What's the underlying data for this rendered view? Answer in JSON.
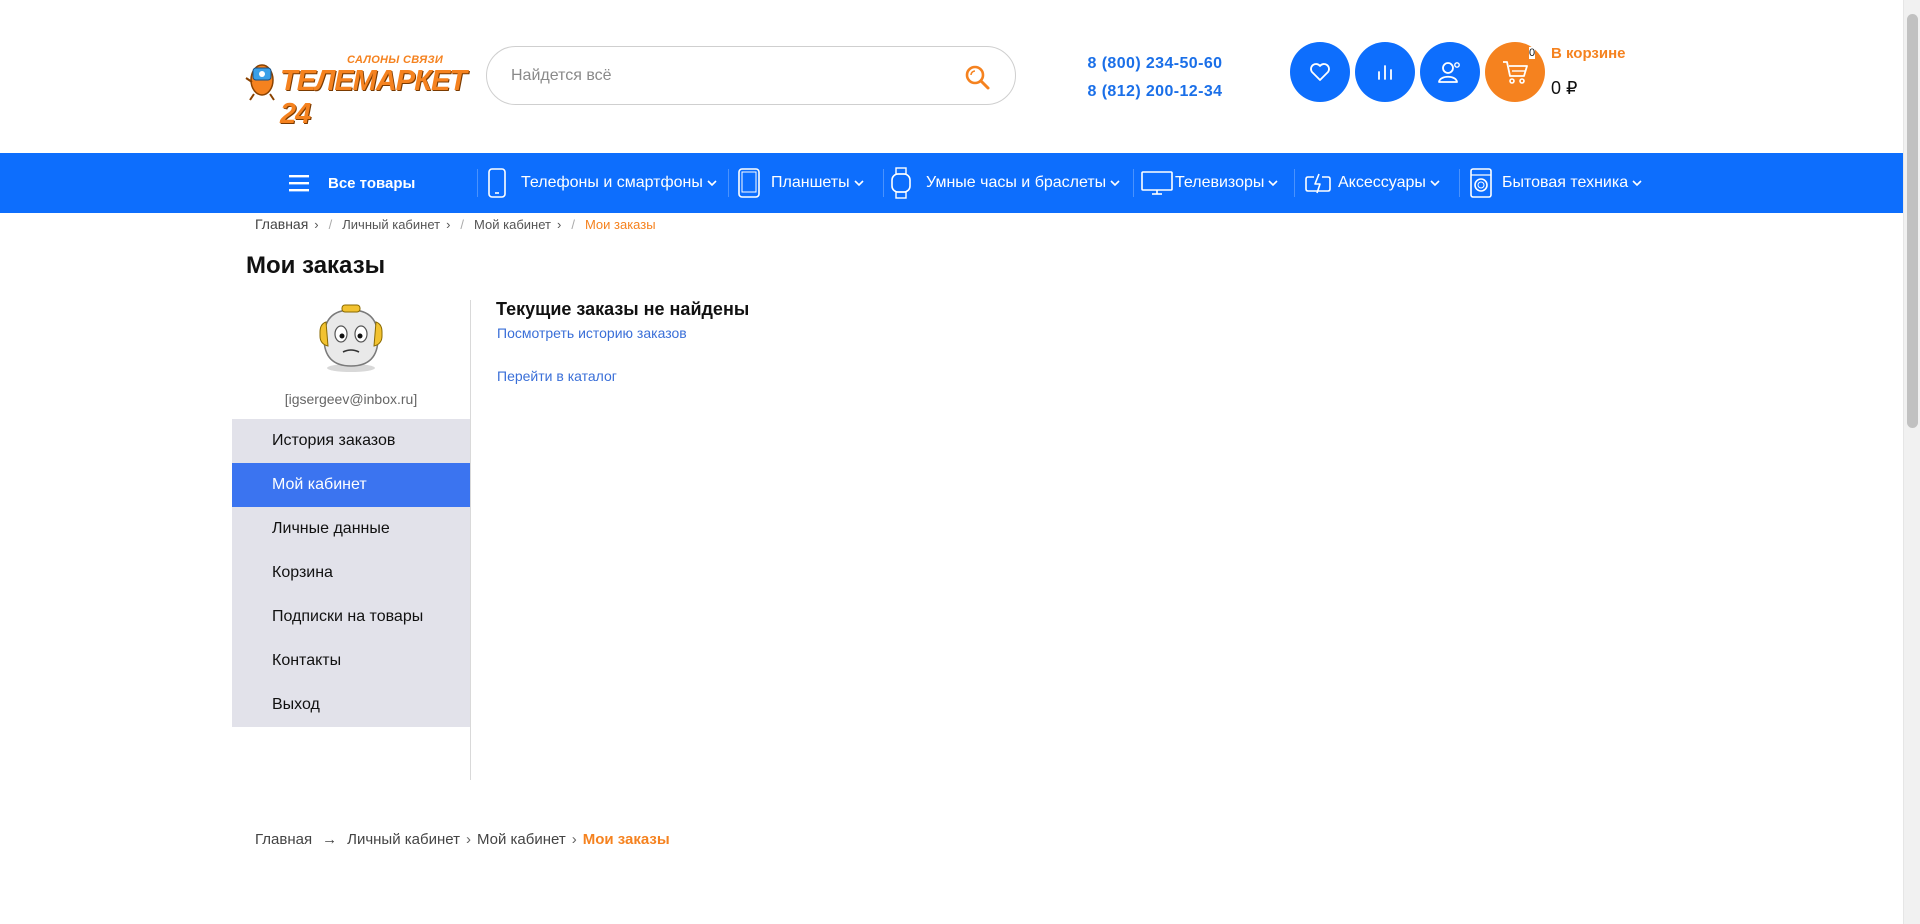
{
  "header": {
    "logo": {
      "subtitle": "САЛОНЫ СВЯЗИ",
      "brand": "ТЕЛЕМАРКЕТ 24"
    },
    "search": {
      "placeholder": "Найдется всё"
    },
    "phones": [
      "8 (800) 234-50-60",
      "8 (812) 200-12-34"
    ],
    "icons": [
      "heart-icon",
      "compare-icon",
      "user-icon",
      "cart-icon"
    ],
    "cart": {
      "count": "0",
      "label": "В корзине",
      "sum": "0 ₽"
    }
  },
  "nav": {
    "all_goods": "Все товары",
    "items": [
      {
        "label": "Телефоны и смартфоны",
        "icon": "phone-icon"
      },
      {
        "label": "Планшеты",
        "icon": "tablet-icon"
      },
      {
        "label": "Умные часы и браслеты",
        "icon": "watch-icon"
      },
      {
        "label": "Телевизоры",
        "icon": "tv-icon"
      },
      {
        "label": "Аксессуары",
        "icon": "battery-icon"
      },
      {
        "label": "Бытовая техника",
        "icon": "washer-icon"
      }
    ]
  },
  "breadcrumb_top": [
    "Главная",
    "Личный кабинет",
    "Мой кабинет",
    "Мои заказы"
  ],
  "page_title": "Мои заказы",
  "sidebar": {
    "email": "[igsergeev@inbox.ru]",
    "items": [
      {
        "label": "История заказов",
        "active": false
      },
      {
        "label": "Мой кабинет",
        "active": true
      },
      {
        "label": "Личные данные",
        "active": false
      },
      {
        "label": "Корзина",
        "active": false
      },
      {
        "label": "Подписки на товары",
        "active": false
      },
      {
        "label": "Контакты",
        "active": false
      },
      {
        "label": "Выход",
        "active": false
      }
    ]
  },
  "content": {
    "empty_title": "Текущие заказы не найдены",
    "history_link": "Посмотреть историю заказов",
    "catalog_link": "Перейти в каталог"
  },
  "breadcrumb_bottom": [
    "Главная",
    "Личный кабинет",
    "Мой кабинет",
    "Мои заказы"
  ],
  "colors": {
    "brand_blue": "#0d6efd",
    "brand_orange": "#f5821f",
    "sidebar_bg": "#e2e2ea",
    "sidebar_active": "#3b74f0"
  }
}
